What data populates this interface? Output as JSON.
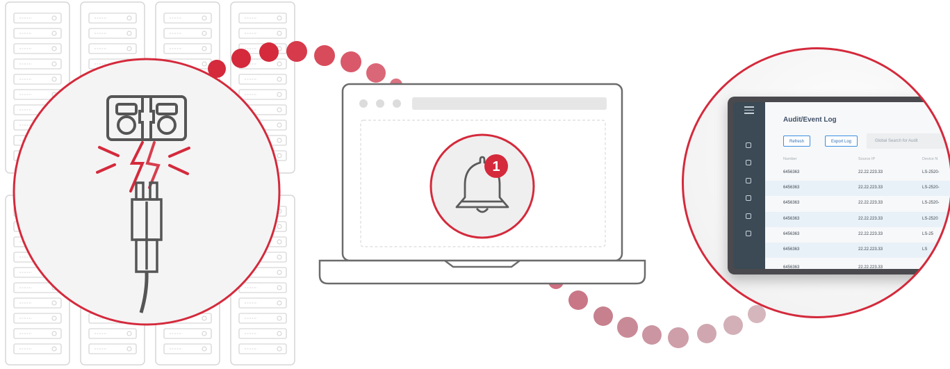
{
  "audit_log": {
    "title": "Audit/Event Log",
    "buttons": {
      "refresh": "Refresh",
      "export": "Export Log"
    },
    "search_placeholder": "Global Search for Audit",
    "columns": [
      "Number",
      "Source IP",
      "Device N"
    ],
    "rows": [
      [
        "6456363",
        "22.22.223.33",
        "LS-2520-"
      ],
      [
        "6456363",
        "22.22.223.33",
        "LS-2520-"
      ],
      [
        "6456363",
        "22.22.223.33",
        "LS-2520-"
      ],
      [
        "6456363",
        "22.22.223.33",
        "LS-2520"
      ],
      [
        "6456363",
        "22.22.223.33",
        "LS-25"
      ],
      [
        "6456363",
        "22.22.223.33",
        "LS"
      ],
      [
        "6456363",
        "22.22.223.33",
        ""
      ]
    ]
  },
  "notification": {
    "count": "1",
    "icon": "bell-icon"
  },
  "colors": {
    "accent": "#d42a3c",
    "sidebar": "#3b4a55",
    "outline": "#d6d6d6",
    "ink": "#555555"
  }
}
